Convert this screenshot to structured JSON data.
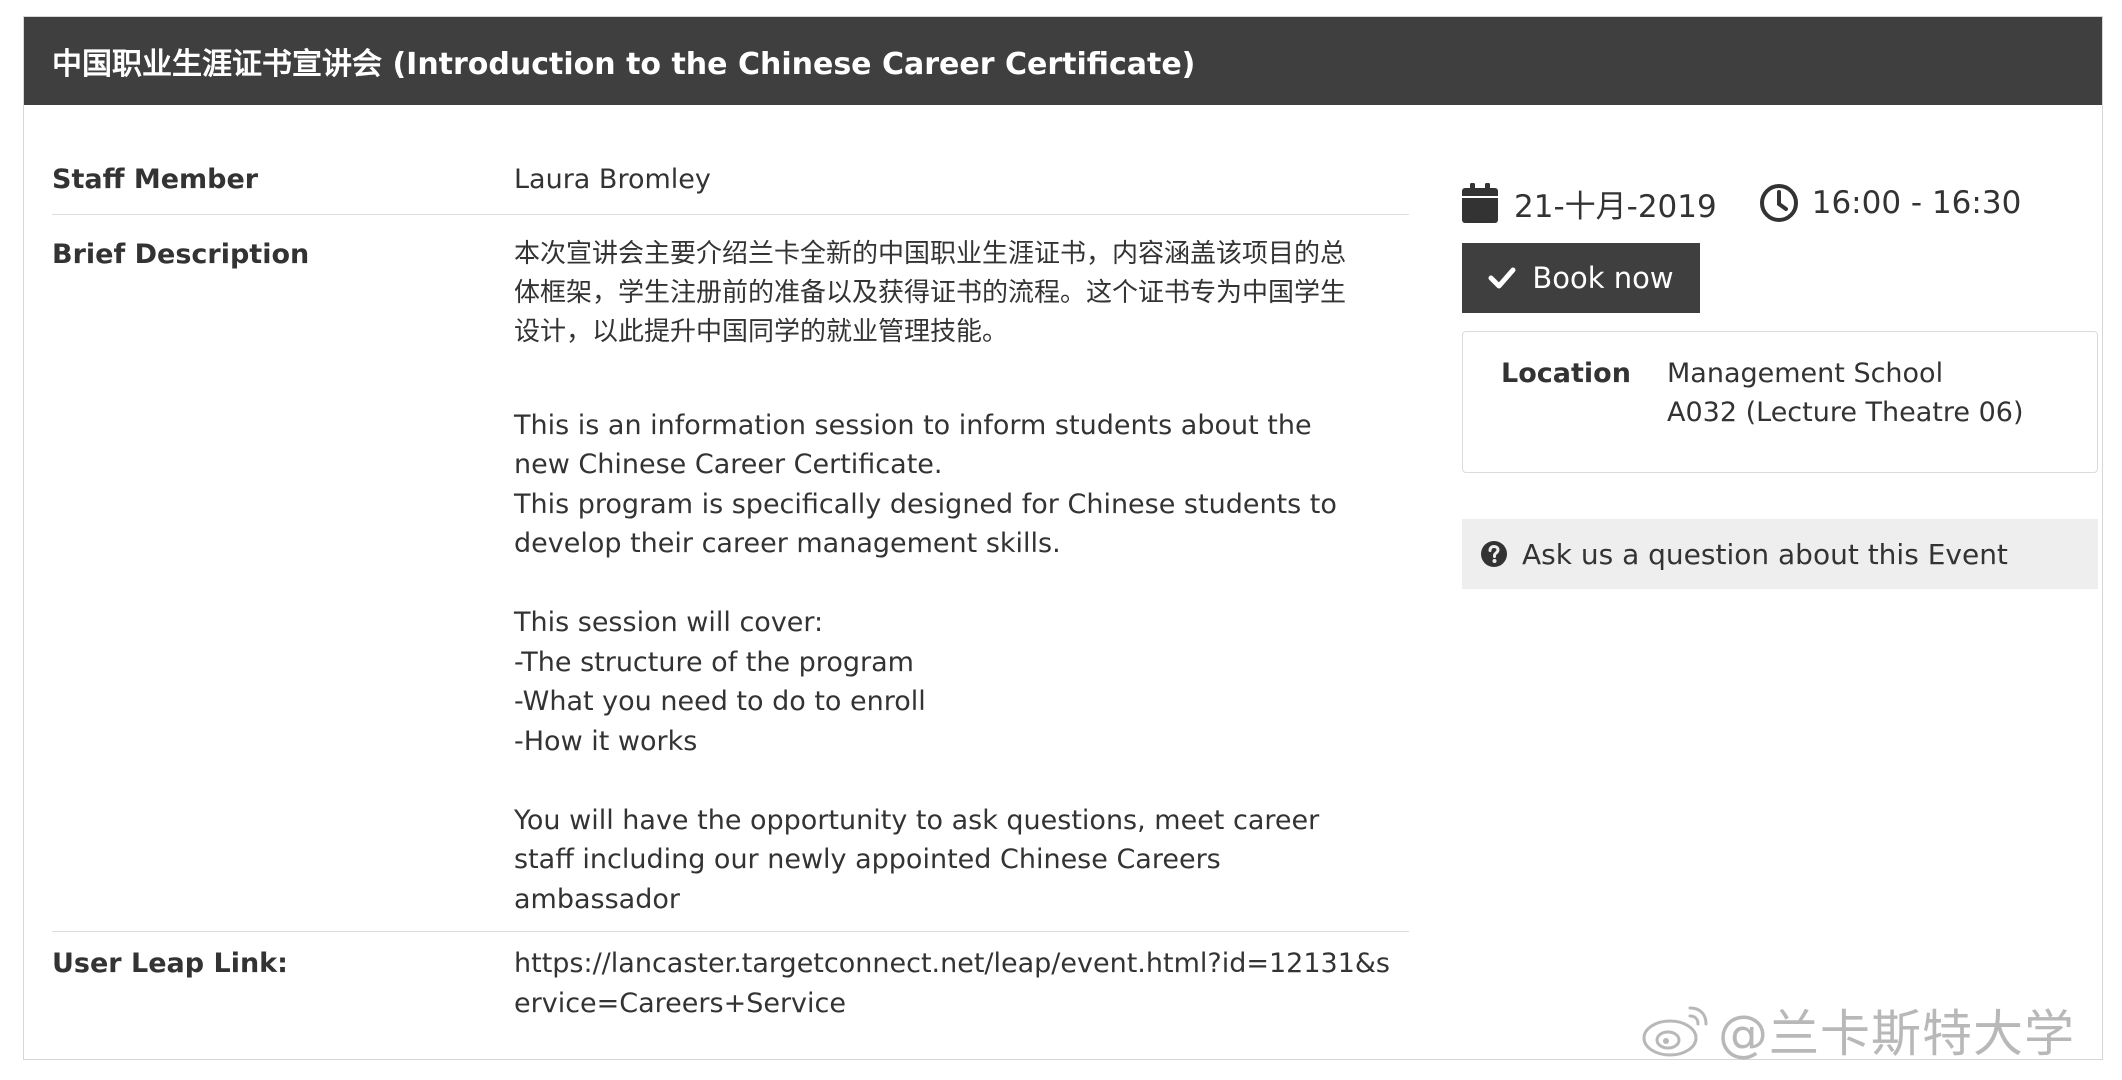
{
  "event": {
    "title": "中国职业生涯证书宣讲会 (Introduction to the Chinese Career Certificate)"
  },
  "details": {
    "staff_label": "Staff Member",
    "staff_value": "Laura Bromley",
    "desc_label": "Brief Description",
    "desc_cn_lines": [
      "本次宣讲会主要介绍兰卡全新的中国职业生涯证书，内容涵盖该项目的总",
      "体框架，学生注册前的准备以及获得证书的流程。这个证书专为中国学生",
      "设计，以此提升中国同学的就业管理技能。"
    ],
    "desc_en_lines": [
      "This is an information session to inform students about the",
      "new Chinese Career Certificate.",
      "This program is specifically designed for Chinese students to",
      "develop their career management skills."
    ],
    "cover_lines": [
      "This session will cover:",
      "-The structure of the program",
      "-What you need to do to enroll",
      "-How it works"
    ],
    "closing_lines": [
      "You will have the opportunity to ask questions, meet career",
      "staff including our newly appointed Chinese Careers",
      "ambassador"
    ],
    "link_label": "User Leap Link:",
    "link_lines": [
      "https://lancaster.targetconnect.net/leap/event.html?id=12131&s",
      "ervice=Careers+Service"
    ]
  },
  "sidebar": {
    "date": "21-十月-2019",
    "time": "16:00 - 16:30",
    "calendar_icon": "calendar-icon",
    "clock_icon": "clock-icon",
    "book_label": "Book now",
    "location_label": "Location",
    "location_lines": [
      "Management School",
      "A032 (Lecture Theatre 06)"
    ],
    "ask_label": "Ask us a question about this Event"
  },
  "watermark": {
    "text": "@兰卡斯特大学"
  },
  "colors": {
    "header_bg": "#3f3f3f",
    "button_bg": "#3f3f3f",
    "ask_bg": "#eeeeee",
    "text": "#333333"
  }
}
